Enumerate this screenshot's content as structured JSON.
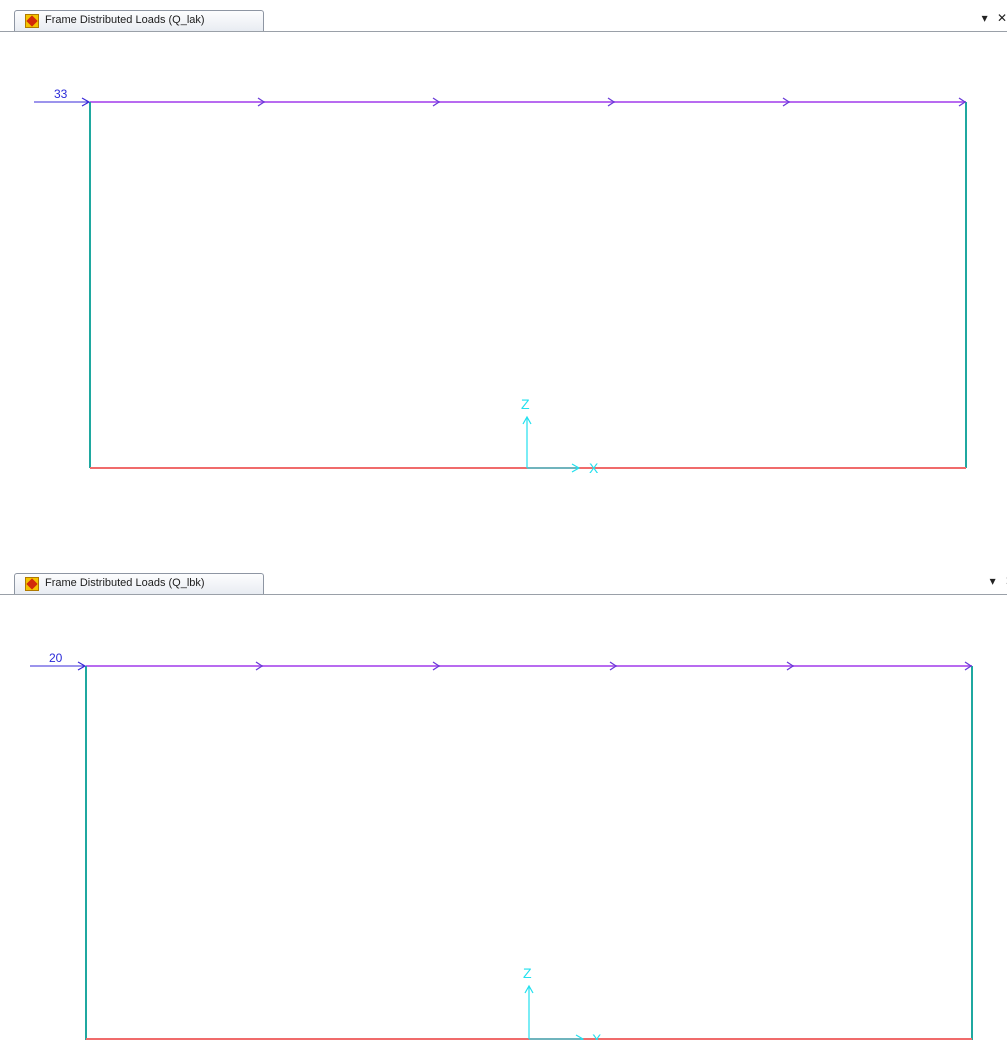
{
  "panels": [
    {
      "tab_title": "Frame Distributed Loads (Q_lak)",
      "load_value": "33",
      "axis_z": "Z",
      "axis_x": "X",
      "dropdown_glyph": "▾",
      "close_glyph": "✕"
    },
    {
      "tab_title": "Frame Distributed Loads (Q_lbk)",
      "load_value": "20",
      "axis_z": "Z",
      "axis_x": "X",
      "dropdown_glyph": "▾",
      "close_glyph": "✕"
    }
  ],
  "colors": {
    "beam": "#b86bf0",
    "column": "#1fa8a0",
    "base": "#f06b6b",
    "load_arrow": "#3a28d8",
    "axis": "#22e0ee",
    "label": "#2a2ad8"
  }
}
